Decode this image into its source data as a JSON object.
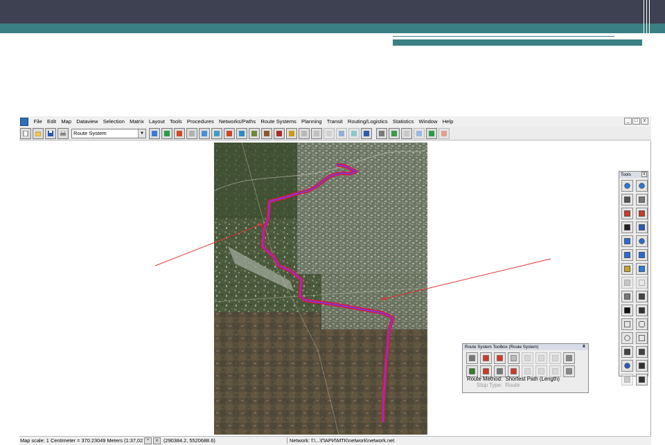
{
  "app": {
    "menu": [
      "File",
      "Edit",
      "Map",
      "Dataview",
      "Selection",
      "Matrix",
      "Layout",
      "Tools",
      "Procedures",
      "Networks/Paths",
      "Route Systems",
      "Planning",
      "Transit",
      "Routing/Logistics",
      "Statistics",
      "Window",
      "Help"
    ],
    "window_controls": [
      "_",
      "□",
      "x"
    ],
    "toolbar": {
      "layer_select_value": "Route System",
      "layer_select_arrow": "▼"
    }
  },
  "tools_palette": {
    "title": "Tools",
    "close": "x"
  },
  "route_toolbox": {
    "title": "Route System Toolbox (Route System)",
    "close": "x",
    "route_method_label": "Route Method:",
    "route_method_value": "Shortest Path (Length)",
    "stop_type_label": "Stop Type:",
    "stop_type_value": "Route"
  },
  "status": {
    "scale_text": "Map scale: 1 Centimeter = 370.23049 Meters (1:37,02",
    "coords": "(290384.2, 5520688.6)",
    "network": "Network: f:\\...\\ПАРИ\\МТК\\network\\network.net"
  },
  "colors": {
    "slide_topbar": "#3e4152",
    "slide_teal": "#3a7f82",
    "route_outer": "#e0153a",
    "route_inner": "#7b3ad6",
    "pointer_line": "#e23030"
  },
  "icons": {
    "toolbar": [
      "new-file-icon",
      "open-folder-icon",
      "save-icon",
      "print-icon",
      "table-icon",
      "chart-icon",
      "map-icon",
      "grid-icon",
      "network-icon",
      "percent-icon",
      "path-icon",
      "route-icon",
      "layers-icon",
      "list-icon",
      "crosshair-icon",
      "pen-icon",
      "globe-icon",
      "tag-icon",
      "chart-dim-icon",
      "scatter-dim-icon",
      "map-dim-icon",
      "loop-icon",
      "theme-icon",
      "cd-icon",
      "export-icon",
      "edit-dim-icon",
      "check-icon",
      "image-dim-icon"
    ],
    "tools": [
      "zoom-in-icon",
      "zoom-out-icon",
      "pan-hand-icon",
      "select-icon",
      "dock-left-icon",
      "dock-right-icon",
      "info-icon",
      "pointer-select-icon",
      "undo-icon",
      "refresh-icon",
      "select-layer-icon",
      "cross-icon",
      "ruler-icon",
      "chart-tool-icon",
      "fork-icon",
      "blank-icon",
      "arrow-select-icon",
      "hand-pointer-icon",
      "text-icon",
      "text-edit-icon",
      "rectangle-icon",
      "rounded-rect-icon",
      "circle-icon",
      "polygon-icon",
      "freehand-icon",
      "curve-icon",
      "star-icon",
      "compass-icon",
      "frame-icon",
      "camera-icon"
    ],
    "route_tools": [
      "select-icon",
      "route-pen-icon",
      "refresh-icon",
      "blank-icon",
      "dim-pen-icon",
      "dim-circle-icon",
      "dim-oval-icon",
      "traffic-icon",
      "table-icon",
      "stop-add-icon",
      "stop-move-icon",
      "stop-delete-icon",
      "dim-stop-icon",
      "dim-stop2-icon",
      "dim-stop3-icon",
      "traffic-stop-icon"
    ]
  }
}
